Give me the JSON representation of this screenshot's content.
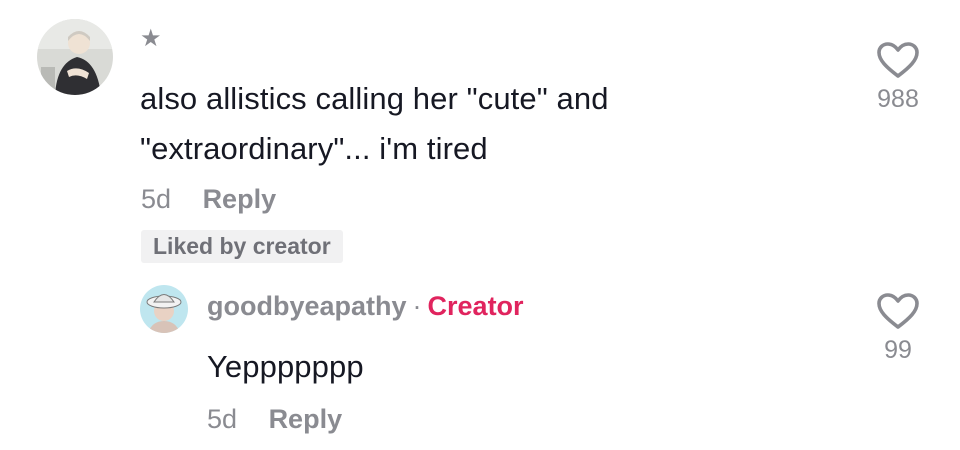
{
  "comment": {
    "badge_icon": "star-icon",
    "text_line1": "also allistics calling her \"cute\" and",
    "text_line2": "\"extraordinary\"... i'm tired",
    "age": "5d",
    "reply_label": "Reply",
    "liked_badge": "Liked by creator",
    "likes": "988"
  },
  "reply": {
    "username": "goodbyeapathy",
    "separator": "·",
    "creator_tag": "Creator",
    "text": "Yeppppppp",
    "age": "5d",
    "reply_label": "Reply",
    "likes": "99"
  },
  "colors": {
    "text_primary": "#161823",
    "text_secondary": "#8a8b91",
    "creator_accent": "#e0245e",
    "badge_bg": "#f1f1f2"
  }
}
